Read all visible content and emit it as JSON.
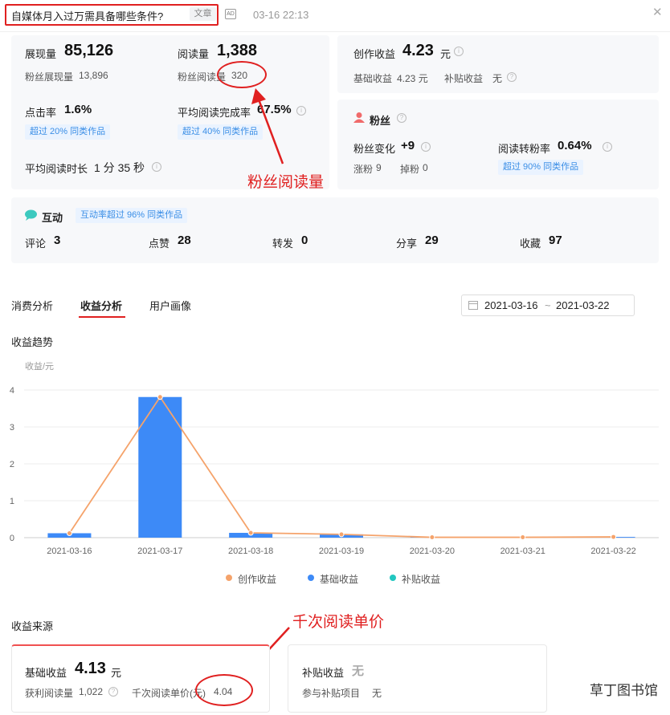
{
  "article": {
    "title": "自媒体月入过万需具备哪些条件?",
    "tag": "文章",
    "ad_label": "AD",
    "date": "03-16 22:13",
    "close_glyph": "✕"
  },
  "stats": {
    "impressions_label": "展现量",
    "impressions_value": "85,126",
    "fan_impressions_label": "粉丝展现量",
    "fan_impressions_value": "13,896",
    "reads_label": "阅读量",
    "reads_value": "1,388",
    "fan_reads_label": "粉丝阅读量",
    "fan_reads_value": "320",
    "ctr_label": "点击率",
    "ctr_value": "1.6%",
    "ctr_badge": "超过 20% 同类作品",
    "completion_label": "平均阅读完成率",
    "completion_value": "67.5%",
    "completion_badge": "超过 40% 同类作品",
    "avg_time_label": "平均阅读时长",
    "avg_time_value": "1 分 35 秒"
  },
  "earnings": {
    "label": "创作收益",
    "value": "4.23",
    "unit": "元",
    "base_label": "基础收益",
    "base_value": "4.23 元",
    "subsidy_label": "补贴收益",
    "subsidy_value": "无"
  },
  "fans": {
    "title": "粉丝",
    "change_label": "粉丝变化",
    "change_value": "+9",
    "conversion_label": "阅读转粉率",
    "conversion_value": "0.64%",
    "gain_label": "涨粉",
    "gain_value": "9",
    "loss_label": "掉粉",
    "loss_value": "0",
    "conversion_badge": "超过 90% 同类作品"
  },
  "interaction": {
    "title": "互动",
    "badge": "互动率超过 96% 同类作品",
    "items": [
      {
        "label": "评论",
        "value": "3"
      },
      {
        "label": "点赞",
        "value": "28"
      },
      {
        "label": "转发",
        "value": "0"
      },
      {
        "label": "分享",
        "value": "29"
      },
      {
        "label": "收藏",
        "value": "97"
      }
    ]
  },
  "annotations": {
    "fan_reads": "粉丝阅读量",
    "cpm": "千次阅读单价"
  },
  "tabs": [
    "消费分析",
    "收益分析",
    "用户画像"
  ],
  "date_range": {
    "start": "2021-03-16",
    "sep": "~",
    "end": "2021-03-22"
  },
  "section_titles": {
    "trend": "收益趋势",
    "source": "收益来源"
  },
  "chart_data": {
    "type": "bar",
    "ylabel": "收益/元",
    "ylim": [
      0,
      4
    ],
    "yticks": [
      "0",
      "1",
      "2",
      "3",
      "4"
    ],
    "categories": [
      "2021-03-16",
      "2021-03-17",
      "2021-03-18",
      "2021-03-19",
      "2021-03-20",
      "2021-03-21",
      "2021-03-22"
    ],
    "series": [
      {
        "name": "创作收益",
        "kind": "line",
        "color": "#f5a36b",
        "values": [
          0.12,
          3.81,
          0.13,
          0.09,
          0.01,
          0.01,
          0.02
        ]
      },
      {
        "name": "基础收益",
        "kind": "bar",
        "color": "#3d8af7",
        "values": [
          0.12,
          3.81,
          0.13,
          0.09,
          0.01,
          0.01,
          0.02
        ]
      },
      {
        "name": "补贴收益",
        "kind": "bar",
        "color": "#22c7c0",
        "values": [
          0,
          0,
          0,
          0,
          0,
          0,
          0
        ]
      }
    ]
  },
  "source": {
    "base_label": "基础收益",
    "base_value": "4.13",
    "base_unit": "元",
    "paid_reads_label": "获利阅读量",
    "paid_reads_value": "1,022",
    "cpm_label": "千次阅读单价(元)",
    "cpm_value": "4.04",
    "subsidy_label": "补贴收益",
    "subsidy_value": "无",
    "subsidy_project_label": "参与补贴项目",
    "subsidy_project_value": "无"
  },
  "watermark": "草丁图书馆"
}
